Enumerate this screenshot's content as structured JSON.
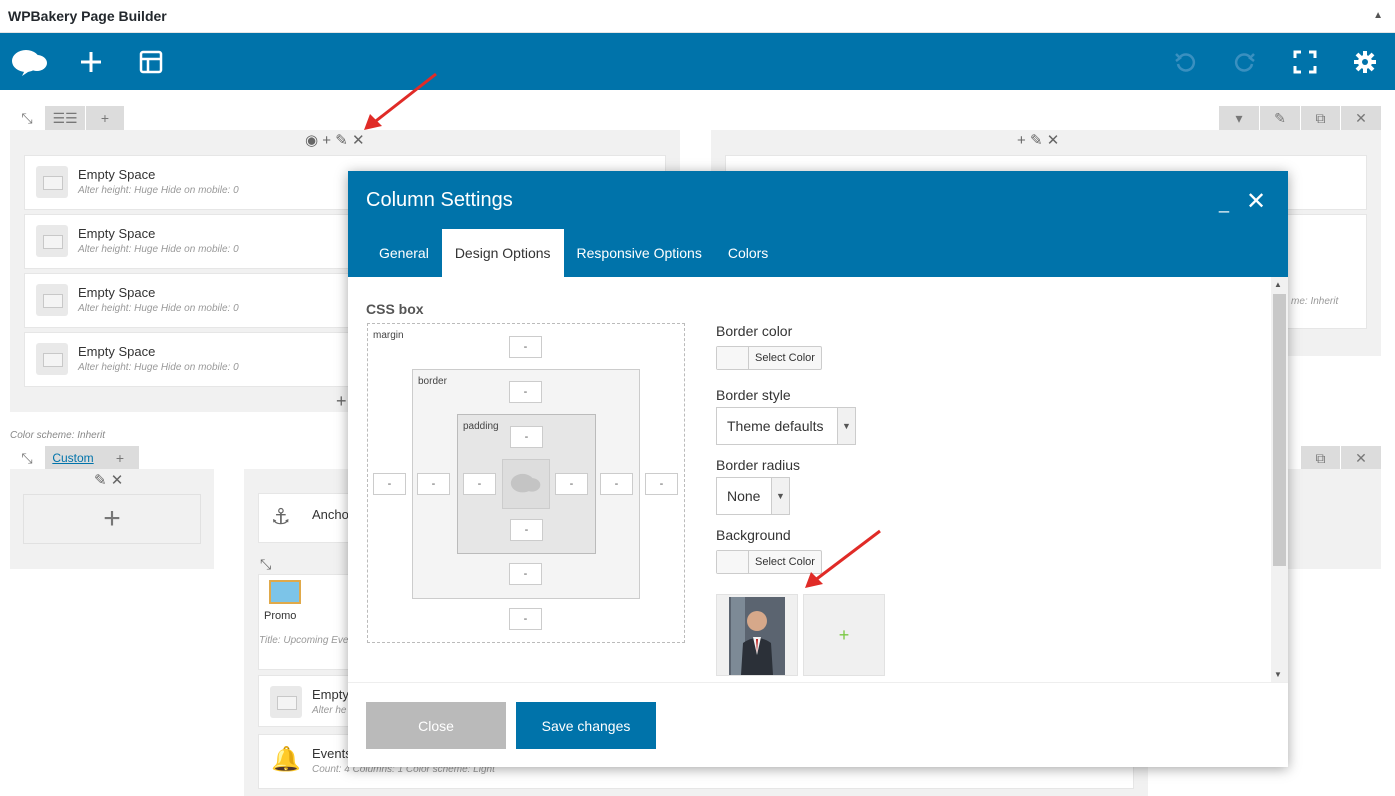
{
  "window": {
    "title": "WPBakery Page Builder",
    "collapse_icon": "caret-up-icon"
  },
  "toolbar": {
    "icons": [
      "wpbakery-logo-icon",
      "add-element-icon",
      "templates-icon",
      "undo-icon",
      "redo-icon",
      "fullscreen-icon",
      "settings-gear-icon"
    ]
  },
  "left_row": {
    "elements": [
      {
        "name": "Empty Space",
        "meta": "Alter height: Huge  Hide on mobile: 0"
      },
      {
        "name": "Empty Space",
        "meta": "Alter height: Huge  Hide on mobile: 0"
      },
      {
        "name": "Empty Space",
        "meta": "Alter height: Huge  Hide on mobile: 0"
      },
      {
        "name": "Empty Space",
        "meta": "Alter height: Huge  Hide on mobile: 0"
      }
    ],
    "color_scheme": "Color scheme: Inherit"
  },
  "right_row": {
    "partial_meta": "me: Inherit"
  },
  "second_row": {
    "custom_label": "Custom",
    "elements": [
      {
        "name": "Ancho",
        "meta": ""
      },
      {
        "name": "Promo",
        "meta": "Title: Upcoming Eve"
      },
      {
        "name": "Empty",
        "meta": "Alter he"
      },
      {
        "name": "Events",
        "meta": "Count: 4  Columns: 1  Color scheme: Light"
      }
    ]
  },
  "modal": {
    "title": "Column Settings",
    "tabs": [
      "General",
      "Design Options",
      "Responsive Options",
      "Colors"
    ],
    "active_tab": "Design Options",
    "css_box": {
      "label": "CSS box",
      "margin_label": "margin",
      "border_label": "border",
      "padding_label": "padding",
      "placeholder": "-"
    },
    "border_color": {
      "label": "Border color",
      "button": "Select Color"
    },
    "border_style": {
      "label": "Border style",
      "value": "Theme defaults"
    },
    "border_radius": {
      "label": "Border radius",
      "value": "None"
    },
    "background": {
      "label": "Background",
      "button": "Select Color",
      "add_symbol": "+"
    },
    "footer": {
      "close": "Close",
      "save": "Save changes"
    }
  },
  "colors": {
    "primary": "#0073aa",
    "arrow": "#e02b27",
    "close_btn": "#bababa"
  }
}
